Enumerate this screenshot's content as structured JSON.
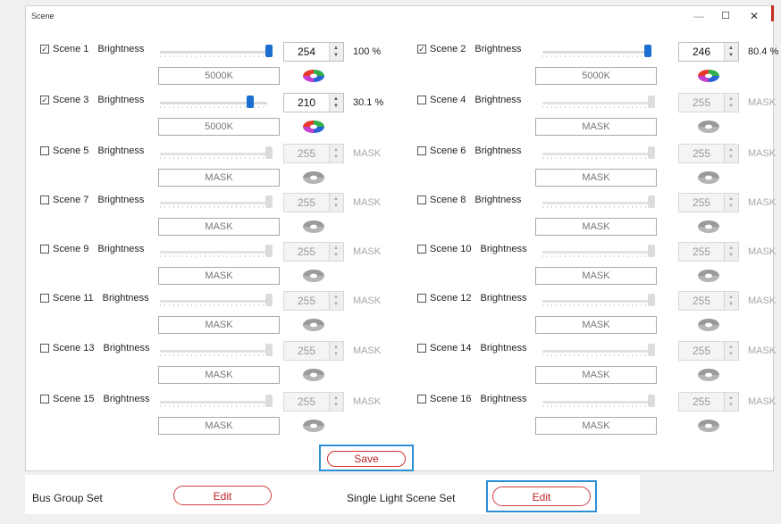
{
  "window": {
    "title": "Scene",
    "minimize_glyph": "—",
    "maximize_glyph": "☐",
    "close_glyph": "✕"
  },
  "scenes": [
    {
      "label": "Scene 1",
      "brightness_label": "Brightness",
      "checked": true,
      "value": "254",
      "percent": "100 %",
      "color_temp": "5000K",
      "enabled": true,
      "level": 0.996
    },
    {
      "label": "Scene 2",
      "brightness_label": "Brightness",
      "checked": true,
      "value": "246",
      "percent": "80.4 %",
      "color_temp": "5000K",
      "enabled": true,
      "level": 0.965
    },
    {
      "label": "Scene 3",
      "brightness_label": "Brightness",
      "checked": true,
      "value": "210",
      "percent": "30.1 %",
      "color_temp": "5000K",
      "enabled": true,
      "level": 0.824
    },
    {
      "label": "Scene 4",
      "brightness_label": "Brightness",
      "checked": false,
      "value": "255",
      "percent": "MASK",
      "color_temp": "MASK",
      "enabled": false,
      "level": 1.0
    },
    {
      "label": "Scene 5",
      "brightness_label": "Brightness",
      "checked": false,
      "value": "255",
      "percent": "MASK",
      "color_temp": "MASK",
      "enabled": false,
      "level": 1.0
    },
    {
      "label": "Scene 6",
      "brightness_label": "Brightness",
      "checked": false,
      "value": "255",
      "percent": "MASK",
      "color_temp": "MASK",
      "enabled": false,
      "level": 1.0
    },
    {
      "label": "Scene 7",
      "brightness_label": "Brightness",
      "checked": false,
      "value": "255",
      "percent": "MASK",
      "color_temp": "MASK",
      "enabled": false,
      "level": 1.0
    },
    {
      "label": "Scene 8",
      "brightness_label": "Brightness",
      "checked": false,
      "value": "255",
      "percent": "MASK",
      "color_temp": "MASK",
      "enabled": false,
      "level": 1.0
    },
    {
      "label": "Scene 9",
      "brightness_label": "Brightness",
      "checked": false,
      "value": "255",
      "percent": "MASK",
      "color_temp": "MASK",
      "enabled": false,
      "level": 1.0
    },
    {
      "label": "Scene 10",
      "brightness_label": "Brightness",
      "checked": false,
      "value": "255",
      "percent": "MASK",
      "color_temp": "MASK",
      "enabled": false,
      "level": 1.0
    },
    {
      "label": "Scene 11",
      "brightness_label": "Brightness",
      "checked": false,
      "value": "255",
      "percent": "MASK",
      "color_temp": "MASK",
      "enabled": false,
      "level": 1.0
    },
    {
      "label": "Scene 12",
      "brightness_label": "Brightness",
      "checked": false,
      "value": "255",
      "percent": "MASK",
      "color_temp": "MASK",
      "enabled": false,
      "level": 1.0
    },
    {
      "label": "Scene 13",
      "brightness_label": "Brightness",
      "checked": false,
      "value": "255",
      "percent": "MASK",
      "color_temp": "MASK",
      "enabled": false,
      "level": 1.0
    },
    {
      "label": "Scene 14",
      "brightness_label": "Brightness",
      "checked": false,
      "value": "255",
      "percent": "MASK",
      "color_temp": "MASK",
      "enabled": false,
      "level": 1.0
    },
    {
      "label": "Scene 15",
      "brightness_label": "Brightness",
      "checked": false,
      "value": "255",
      "percent": "MASK",
      "color_temp": "MASK",
      "enabled": false,
      "level": 1.0
    },
    {
      "label": "Scene 16",
      "brightness_label": "Brightness",
      "checked": false,
      "value": "255",
      "percent": "MASK",
      "color_temp": "MASK",
      "enabled": false,
      "level": 1.0
    }
  ],
  "save_label": "Save",
  "bottom": {
    "bus_group_label": "Bus Group Set",
    "bus_group_edit": "Edit",
    "single_light_label": "Single Light Scene Set",
    "single_light_edit": "Edit"
  },
  "icons": {
    "color_wheel": "color-wheel-icon",
    "spinner_up": "▲",
    "spinner_down": "▼"
  },
  "colors": {
    "accent_blue": "#1a6fd0",
    "focus_border": "#2b8fd6",
    "button_red": "#c02020",
    "wheel_red": "#e63a2e",
    "wheel_green": "#2fae4a",
    "wheel_blue": "#2a62d6",
    "wheel_magenta": "#c43fd0",
    "wheel_disabled": "#9a9a9a"
  }
}
